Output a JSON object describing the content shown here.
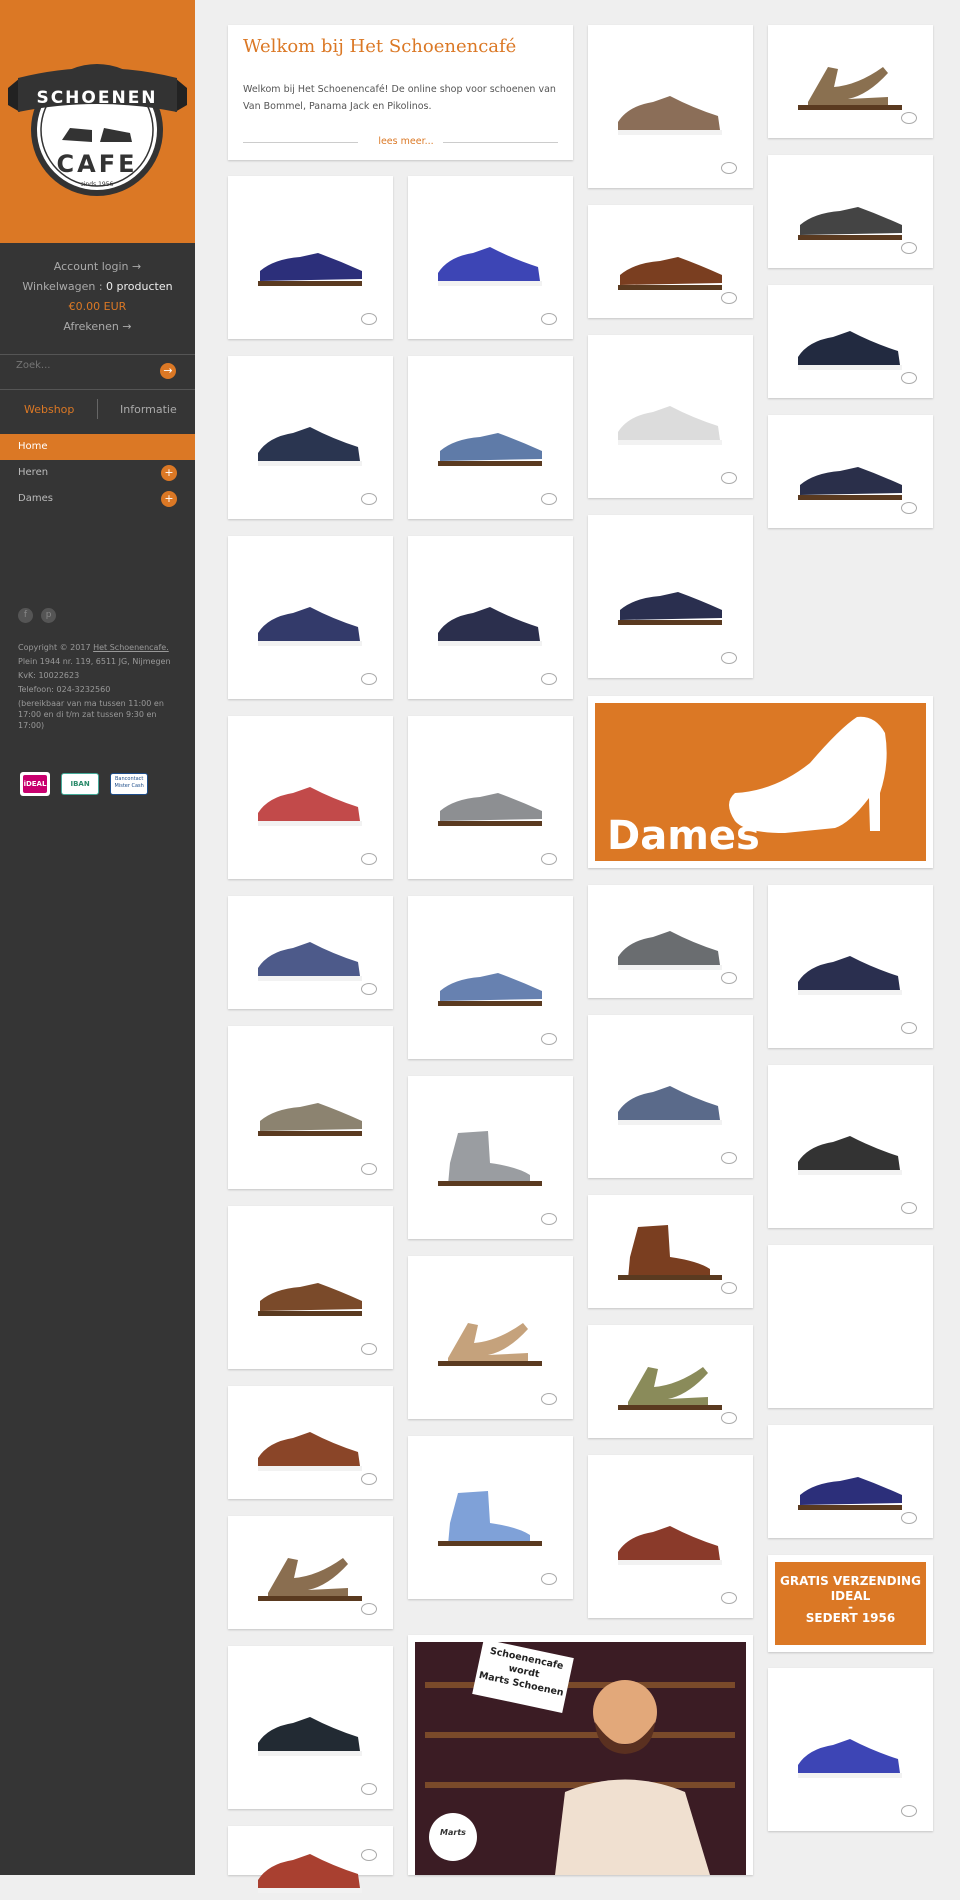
{
  "logo": {
    "line1": "SCHOENEN",
    "line2": "CAFE",
    "since": "sinds 1956"
  },
  "account": {
    "login": "Account login →",
    "cart_label": "Winkelwagen :",
    "cart_value": "0 producten",
    "cart_total": "€0.00 EUR",
    "checkout": "Afrekenen →"
  },
  "search": {
    "placeholder": "Zoek...",
    "button": "→"
  },
  "tabs": {
    "webshop": "Webshop",
    "info": "Informatie"
  },
  "nav": {
    "home": "Home",
    "heren": "Heren",
    "dames": "Dames",
    "expand": "+"
  },
  "social": {
    "facebook": "f",
    "pinterest": "p"
  },
  "footer": {
    "copyright": "Copyright © 2017",
    "link": "Het Schoenencafe.",
    "address": "Plein 1944 nr. 119, 6511 JG, Nijmegen",
    "kvk": "KvK: 10022623",
    "phone": "Telefoon: 024-3232560",
    "hours": "(bereikbaar van ma tussen 11:00 en 17:00 en di t/m zat tussen 9:30 en 17:00)"
  },
  "payments": {
    "ideal": "iDEAL",
    "iban": "IBAN",
    "bancontact": "Bancontact Mister Cash"
  },
  "welcome": {
    "title": "Welkom bij Het Schoenencafé",
    "text": "Welkom bij Het Schoenencafé! De online shop voor schoenen van Van Bommel, Panama Jack en Pikolinos.",
    "more": "lees meer..."
  },
  "banners": {
    "dames": "Dames",
    "shipping": [
      "GRATIS VERZENDING",
      "IDEAL",
      "-",
      "SEDERT 1956"
    ],
    "marts": [
      "Schoenencafe",
      "wordt",
      "Marts Schoenen"
    ],
    "marts_logo": "Marts"
  },
  "colors": {
    "brand": "#db7825",
    "sidebar": "#353535",
    "background": "#efefef"
  },
  "products": [
    {
      "color": "#2c2f7a",
      "kind": "shoe"
    },
    {
      "color": "#3d45b5",
      "kind": "sneaker"
    },
    {
      "color": "#2a3550",
      "kind": "sneaker"
    },
    {
      "color": "#5f7ba8",
      "kind": "shoe"
    },
    {
      "color": "#333a6a",
      "kind": "sneaker"
    },
    {
      "color": "#2b2f4d",
      "kind": "sneaker"
    },
    {
      "color": "#c24a4a",
      "kind": "sneaker"
    },
    {
      "color": "#8d8f92",
      "kind": "shoe"
    },
    {
      "color": "#4d5a8a",
      "kind": "sneaker"
    },
    {
      "color": "#6781b0",
      "kind": "shoe"
    },
    {
      "color": "#8c8370",
      "kind": "shoe"
    },
    {
      "color": "#9a9da1",
      "kind": "boot"
    },
    {
      "color": "#7a4a2a",
      "kind": "shoe"
    },
    {
      "color": "#c5a27c",
      "kind": "sandal"
    },
    {
      "color": "#8a4528",
      "kind": "sneaker"
    },
    {
      "color": "#7fa1d8",
      "kind": "boot"
    },
    {
      "color": "#8a6e50",
      "kind": "sandal"
    },
    {
      "color": "#222a33",
      "kind": "sneaker"
    },
    {
      "color": "#a94030",
      "kind": "sneaker"
    },
    {
      "color": "#8b6e58",
      "kind": "sneaker"
    },
    {
      "color": "#7a3e20",
      "kind": "shoe"
    },
    {
      "color": "#dcdcdc",
      "kind": "sneaker"
    },
    {
      "color": "#2a2f4f",
      "kind": "shoe"
    },
    {
      "color": "#6a6d70",
      "kind": "sneaker"
    },
    {
      "color": "#5a6a8a",
      "kind": "sneaker"
    },
    {
      "color": "#7a3e20",
      "kind": "boot"
    },
    {
      "color": "#8a8b5a",
      "kind": "sandal"
    },
    {
      "color": "#8a3a2a",
      "kind": "sneaker"
    },
    {
      "color": "#8a7050",
      "kind": "sandal"
    },
    {
      "color": "#444",
      "kind": "shoe"
    },
    {
      "color": "#222a40",
      "kind": "sneaker"
    },
    {
      "color": "#2a2f4a",
      "kind": "shoe"
    },
    {
      "color": "#2a2f4f",
      "kind": "sneaker"
    },
    {
      "color": "#333",
      "kind": "sneaker"
    },
    {
      "color": "#ddd",
      "kind": "blank"
    }
  ]
}
